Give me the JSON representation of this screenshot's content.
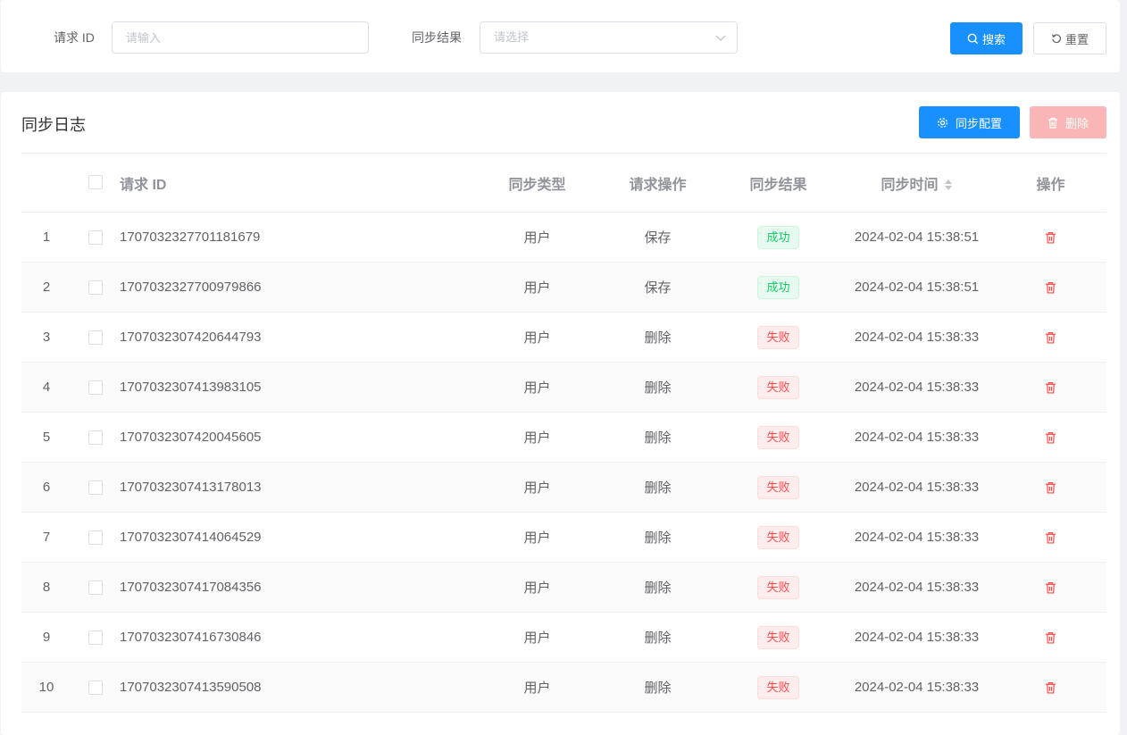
{
  "search": {
    "request_id_label": "请求 ID",
    "request_id_placeholder": "请输入",
    "result_label": "同步结果",
    "result_placeholder": "请选择",
    "search_button": "搜索",
    "reset_button": "重置"
  },
  "panel": {
    "title": "同步日志",
    "config_button": "同步配置",
    "delete_button": "删除"
  },
  "table": {
    "headers": {
      "request_id": "请求 ID",
      "sync_type": "同步类型",
      "request_action": "请求操作",
      "sync_result": "同步结果",
      "sync_time": "同步时间",
      "actions": "操作"
    },
    "rows": [
      {
        "index": "1",
        "request_id": "1707032327701181679",
        "sync_type": "用户",
        "request_action": "保存",
        "sync_result": "成功",
        "sync_time": "2024-02-04 15:38:51"
      },
      {
        "index": "2",
        "request_id": "1707032327700979866",
        "sync_type": "用户",
        "request_action": "保存",
        "sync_result": "成功",
        "sync_time": "2024-02-04 15:38:51"
      },
      {
        "index": "3",
        "request_id": "1707032307420644793",
        "sync_type": "用户",
        "request_action": "删除",
        "sync_result": "失败",
        "sync_time": "2024-02-04 15:38:33"
      },
      {
        "index": "4",
        "request_id": "1707032307413983105",
        "sync_type": "用户",
        "request_action": "删除",
        "sync_result": "失败",
        "sync_time": "2024-02-04 15:38:33"
      },
      {
        "index": "5",
        "request_id": "1707032307420045605",
        "sync_type": "用户",
        "request_action": "删除",
        "sync_result": "失败",
        "sync_time": "2024-02-04 15:38:33"
      },
      {
        "index": "6",
        "request_id": "1707032307413178013",
        "sync_type": "用户",
        "request_action": "删除",
        "sync_result": "失败",
        "sync_time": "2024-02-04 15:38:33"
      },
      {
        "index": "7",
        "request_id": "1707032307414064529",
        "sync_type": "用户",
        "request_action": "删除",
        "sync_result": "失败",
        "sync_time": "2024-02-04 15:38:33"
      },
      {
        "index": "8",
        "request_id": "1707032307417084356",
        "sync_type": "用户",
        "request_action": "删除",
        "sync_result": "失败",
        "sync_time": "2024-02-04 15:38:33"
      },
      {
        "index": "9",
        "request_id": "1707032307416730846",
        "sync_type": "用户",
        "request_action": "删除",
        "sync_result": "失败",
        "sync_time": "2024-02-04 15:38:33"
      },
      {
        "index": "10",
        "request_id": "1707032307413590508",
        "sync_type": "用户",
        "request_action": "删除",
        "sync_result": "失败",
        "sync_time": "2024-02-04 15:38:33"
      }
    ]
  },
  "colors": {
    "primary": "#1890ff",
    "success": "#13ce66",
    "danger": "#ff4949",
    "disabled_danger": "#fab6b6"
  }
}
